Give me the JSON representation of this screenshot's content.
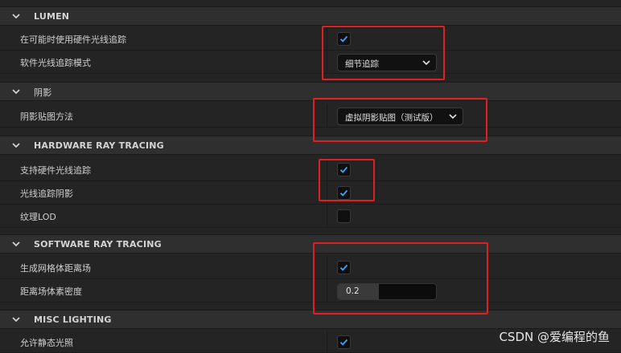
{
  "sections": {
    "lumen": {
      "title": "LUMEN"
    },
    "shadows": {
      "title": "阴影"
    },
    "hardware_rt": {
      "title": "HARDWARE RAY TRACING"
    },
    "software_rt": {
      "title": "SOFTWARE RAY TRACING"
    },
    "misc_lighting": {
      "title": "MISC LIGHTING"
    }
  },
  "rows": {
    "use_hw_rt_when_available": {
      "label": "在可能时使用硬件光线追踪",
      "checked": true
    },
    "sw_rt_mode": {
      "label": "软件光线追踪模式",
      "value": "细节追踪"
    },
    "shadow_map_method": {
      "label": "阴影贴图方法",
      "value": "虚拟阴影贴图（测试版）"
    },
    "support_hw_rt": {
      "label": "支持硬件光线追踪",
      "checked": true
    },
    "rt_shadows": {
      "label": "光线追踪阴影",
      "checked": true
    },
    "texture_lod": {
      "label": "纹理LOD",
      "checked": false
    },
    "generate_mesh_df": {
      "label": "生成网格体距离场",
      "checked": true
    },
    "df_voxel_density": {
      "label": "距离场体素密度",
      "value": "0.2",
      "fill_fraction": 0.42
    },
    "allow_static_lighting": {
      "label": "允许静态光照",
      "checked": true
    }
  },
  "watermark": "CSDN @爱编程的鱼",
  "colors": {
    "accent_check": "#3da0ff",
    "highlight": "#e02020",
    "background": "#242424",
    "header": "#2f2f2f"
  }
}
